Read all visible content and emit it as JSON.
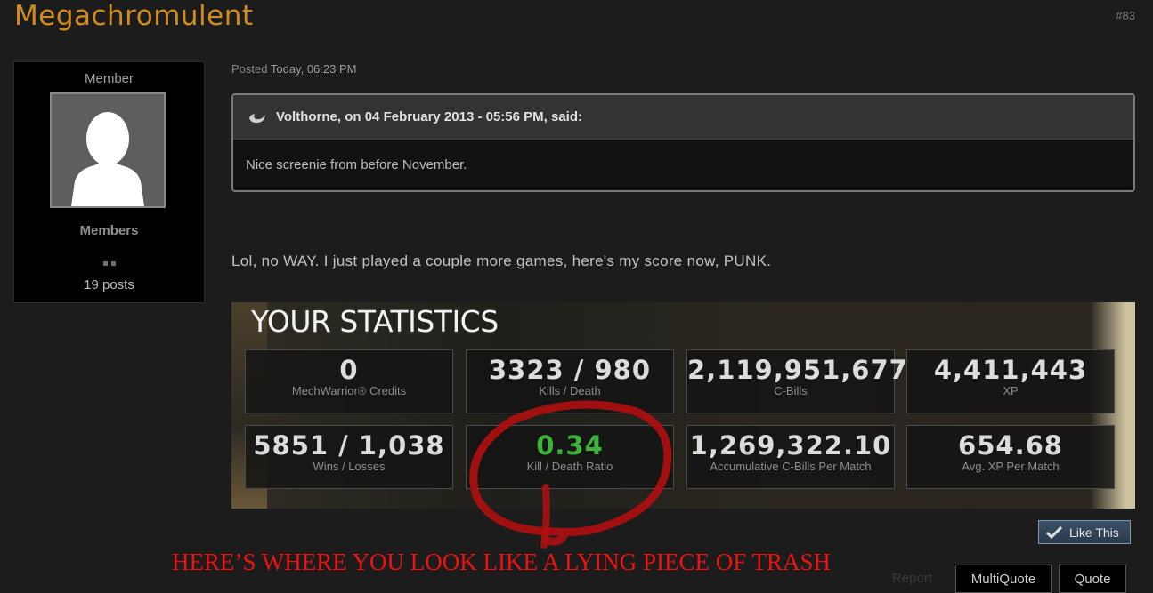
{
  "post": {
    "author": "Megachromulent",
    "number": "#83",
    "posted_label": "Posted",
    "posted_date": "Today, 06:23 PM",
    "body_text": "Lol, no WAY. I just played a couple more games, here's my score now, PUNK."
  },
  "user": {
    "role": "Member",
    "group": "Members",
    "posts": "19 posts"
  },
  "quote": {
    "header": "Volthorne, on 04 February 2013 - 05:56 PM, said:",
    "body": "Nice screenie from before November."
  },
  "stats": {
    "title": "YOUR STATISTICS",
    "tiles": [
      {
        "value": "0",
        "label": "MechWarrior® Credits"
      },
      {
        "value": "3323 / 980",
        "label": "Kills / Death"
      },
      {
        "value": "2,119,951,677",
        "label": "C-Bills"
      },
      {
        "value": "4,411,443",
        "label": "XP"
      },
      {
        "value": "5851 / 1,038",
        "label": "Wins / Losses"
      },
      {
        "value": "0.34",
        "label": "Kill / Death Ratio"
      },
      {
        "value": "1,269,322.10",
        "label": "Accumulative C-Bills Per Match"
      },
      {
        "value": "654.68",
        "label": "Avg. XP Per Match"
      }
    ]
  },
  "annotation": "HERE’S WHERE YOU LOOK LIKE A LYING PIECE OF TRASH",
  "actions": {
    "like": "Like This",
    "report": "Report",
    "multiquote": "MultiQuote",
    "quote": "Quote"
  },
  "colors": {
    "username": "#d08b1f",
    "highlight_value": "#3cb43c",
    "annotation": "#ee1111",
    "circle": "#b01010"
  },
  "icons": [
    "quote-icon",
    "avatar-silhouette-icon",
    "check-icon"
  ]
}
